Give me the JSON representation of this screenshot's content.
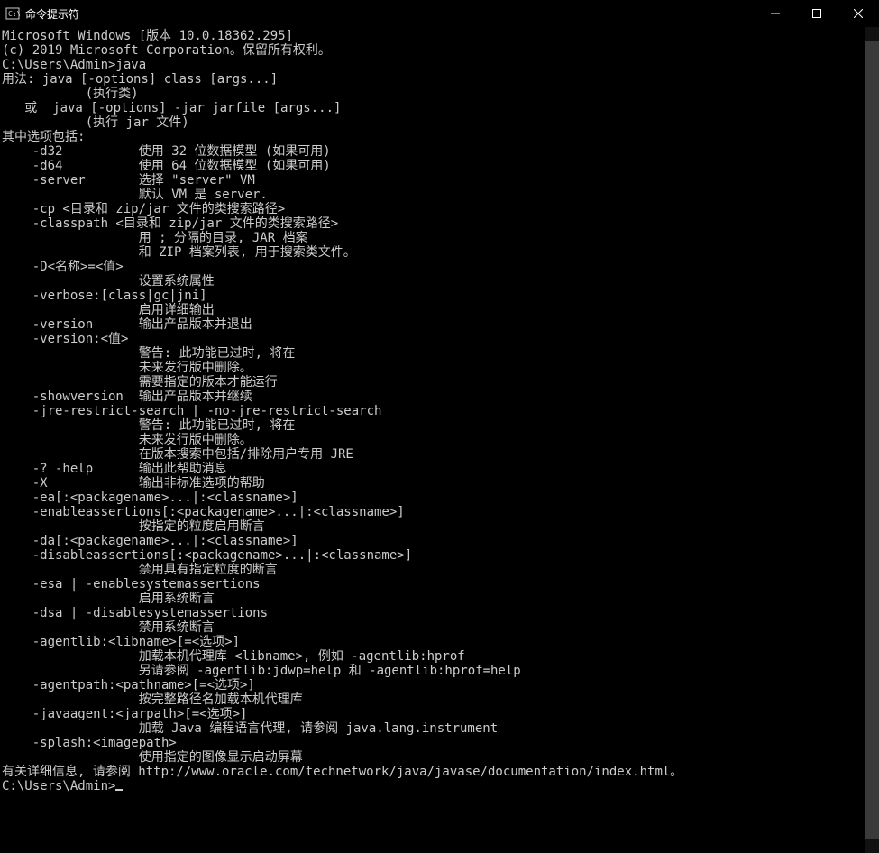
{
  "window": {
    "title": "命令提示符"
  },
  "terminal": {
    "lines": [
      "Microsoft Windows [版本 10.0.18362.295]",
      "(c) 2019 Microsoft Corporation。保留所有权利。",
      "",
      "C:\\Users\\Admin>java",
      "用法: java [-options] class [args...]",
      "           (执行类)",
      "   或  java [-options] -jar jarfile [args...]",
      "           (执行 jar 文件)",
      "其中选项包括:",
      "    -d32          使用 32 位数据模型 (如果可用)",
      "    -d64          使用 64 位数据模型 (如果可用)",
      "    -server       选择 \"server\" VM",
      "                  默认 VM 是 server.",
      "",
      "    -cp <目录和 zip/jar 文件的类搜索路径>",
      "    -classpath <目录和 zip/jar 文件的类搜索路径>",
      "                  用 ; 分隔的目录, JAR 档案",
      "                  和 ZIP 档案列表, 用于搜索类文件。",
      "    -D<名称>=<值>",
      "                  设置系统属性",
      "    -verbose:[class|gc|jni]",
      "                  启用详细输出",
      "    -version      输出产品版本并退出",
      "    -version:<值>",
      "                  警告: 此功能已过时, 将在",
      "                  未来发行版中删除。",
      "                  需要指定的版本才能运行",
      "    -showversion  输出产品版本并继续",
      "    -jre-restrict-search | -no-jre-restrict-search",
      "                  警告: 此功能已过时, 将在",
      "                  未来发行版中删除。",
      "                  在版本搜索中包括/排除用户专用 JRE",
      "    -? -help      输出此帮助消息",
      "    -X            输出非标准选项的帮助",
      "    -ea[:<packagename>...|:<classname>]",
      "    -enableassertions[:<packagename>...|:<classname>]",
      "                  按指定的粒度启用断言",
      "    -da[:<packagename>...|:<classname>]",
      "    -disableassertions[:<packagename>...|:<classname>]",
      "                  禁用具有指定粒度的断言",
      "    -esa | -enablesystemassertions",
      "                  启用系统断言",
      "    -dsa | -disablesystemassertions",
      "                  禁用系统断言",
      "    -agentlib:<libname>[=<选项>]",
      "                  加载本机代理库 <libname>, 例如 -agentlib:hprof",
      "                  另请参阅 -agentlib:jdwp=help 和 -agentlib:hprof=help",
      "    -agentpath:<pathname>[=<选项>]",
      "                  按完整路径名加载本机代理库",
      "    -javaagent:<jarpath>[=<选项>]",
      "                  加载 Java 编程语言代理, 请参阅 java.lang.instrument",
      "    -splash:<imagepath>",
      "                  使用指定的图像显示启动屏幕",
      "有关详细信息, 请参阅 http://www.oracle.com/technetwork/java/javase/documentation/index.html。",
      "",
      "C:\\Users\\Admin>"
    ],
    "prompt_after_last": true
  }
}
